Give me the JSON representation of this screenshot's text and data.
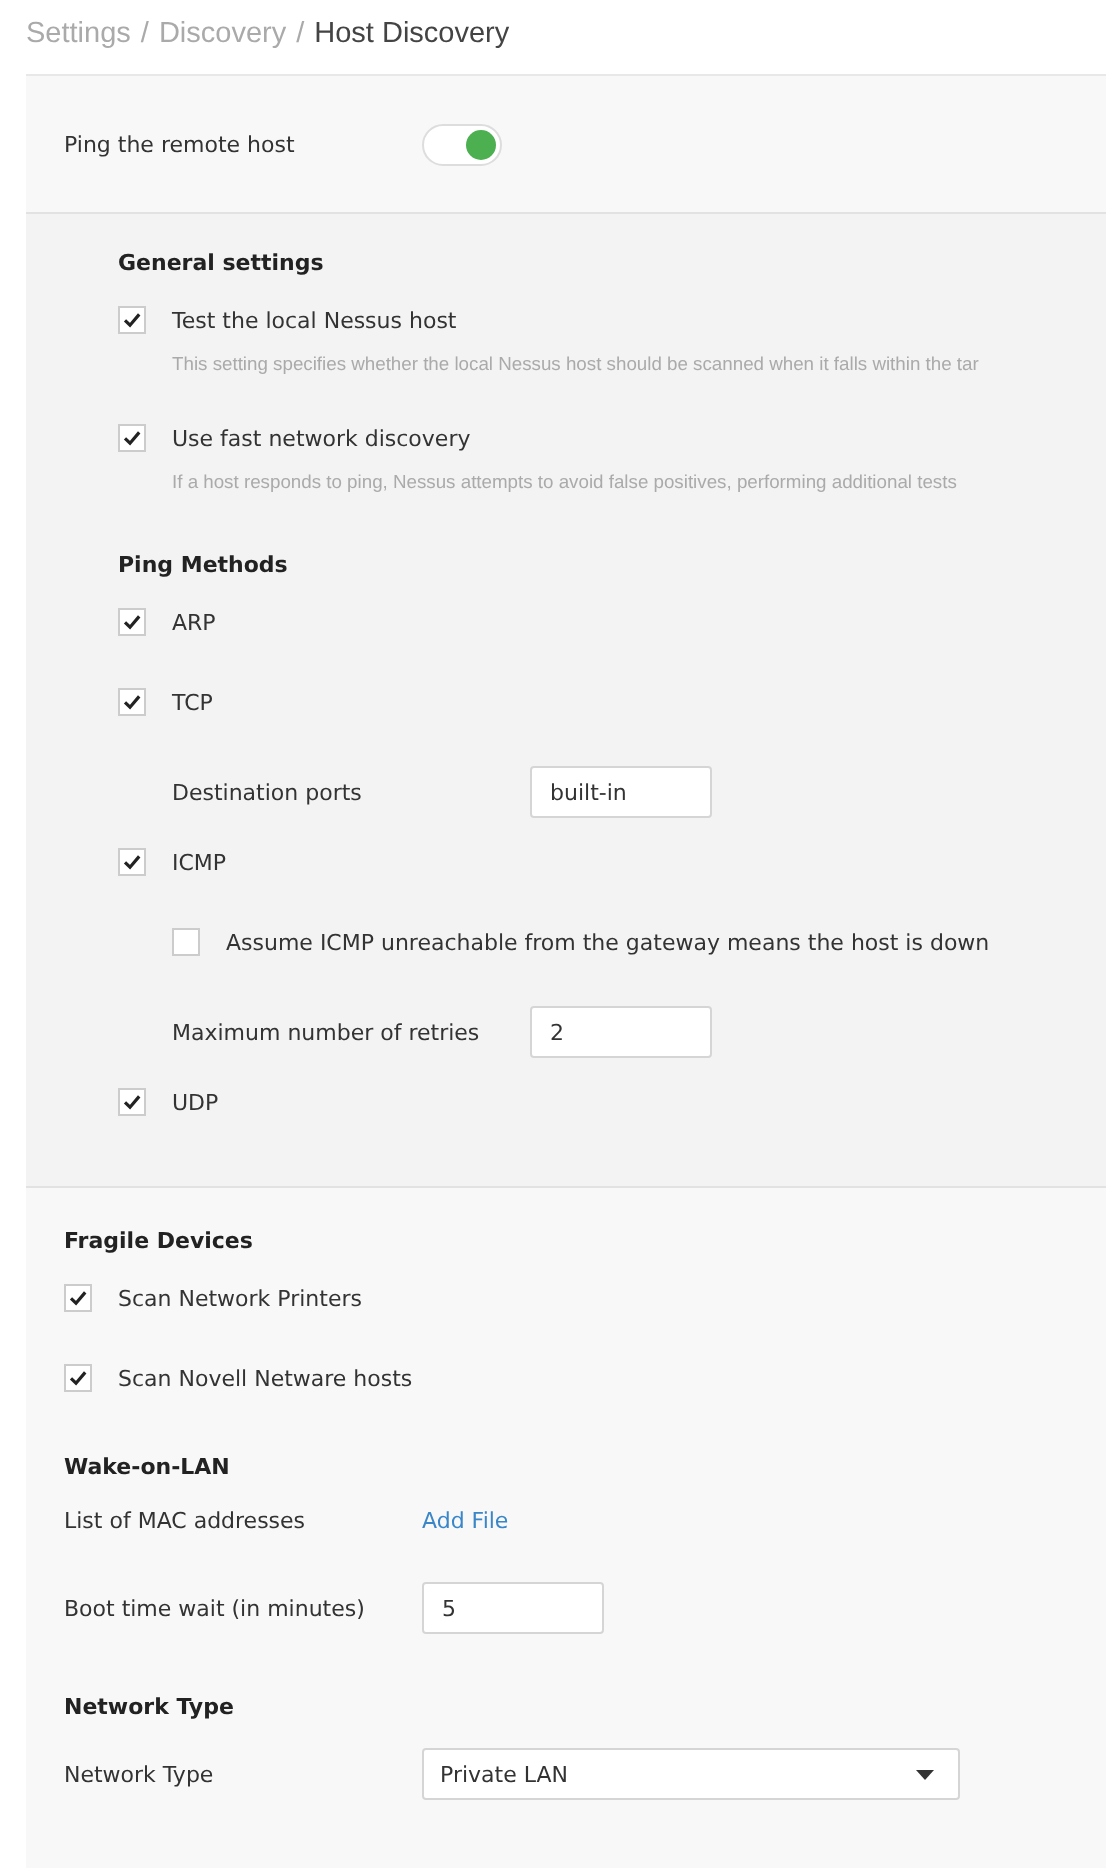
{
  "breadcrumb_separator": "/",
  "breadcrumb": [
    {
      "label": "Settings",
      "current": false
    },
    {
      "label": "Discovery",
      "current": false
    },
    {
      "label": "Host Discovery",
      "current": true
    }
  ],
  "ping_remote_host": {
    "label": "Ping the remote host",
    "on": true
  },
  "ping_settings": [
    {
      "heading": "General settings",
      "items": [
        {
          "kind": "checkbox",
          "label": "Test the local Nessus host",
          "checked": true,
          "description": "This setting specifies whether the local Nessus host should be scanned when it falls within the tar"
        },
        {
          "kind": "checkbox",
          "label": "Use fast network discovery",
          "checked": true,
          "description": "If a host responds to ping, Nessus attempts to avoid false positives, performing additional tests"
        }
      ]
    },
    {
      "heading": "Ping Methods",
      "items": [
        {
          "kind": "checkbox",
          "label": "ARP",
          "checked": true
        },
        {
          "kind": "checkbox",
          "label": "TCP",
          "checked": true,
          "children": [
            {
              "kind": "field",
              "label": "Destination ports",
              "value": "built-in"
            }
          ]
        },
        {
          "kind": "checkbox",
          "label": "ICMP",
          "checked": true,
          "children": [
            {
              "kind": "checkbox",
              "label": "Assume ICMP unreachable from the gateway means the host is down",
              "checked": false
            },
            {
              "kind": "field",
              "label": "Maximum number of retries",
              "value": "2"
            }
          ]
        },
        {
          "kind": "checkbox",
          "label": "UDP",
          "checked": true
        }
      ]
    }
  ],
  "sections": [
    {
      "heading": "Fragile Devices",
      "items": [
        {
          "kind": "checkbox",
          "label": "Scan Network Printers",
          "checked": true
        },
        {
          "kind": "checkbox",
          "label": "Scan Novell Netware hosts",
          "checked": true
        }
      ]
    },
    {
      "heading": "Wake-on-LAN",
      "items": [
        {
          "kind": "link",
          "label": "List of MAC addresses",
          "link": "Add File"
        },
        {
          "kind": "field",
          "label": "Boot time wait (in minutes)",
          "value": "5"
        }
      ]
    },
    {
      "heading": "Network Type",
      "items": [
        {
          "kind": "select",
          "label": "Network Type",
          "value": "Private LAN"
        }
      ]
    }
  ]
}
